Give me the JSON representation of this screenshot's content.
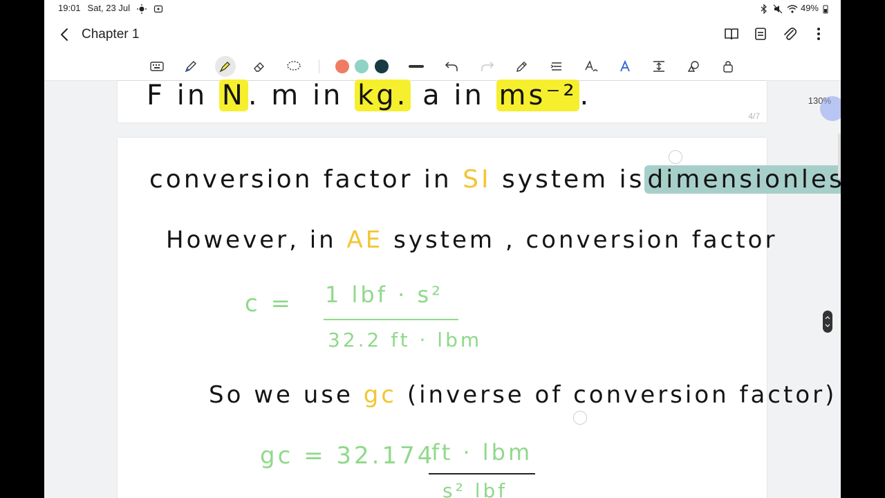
{
  "status": {
    "time": "19:01",
    "date": "Sat, 23 Jul",
    "battery": "49%"
  },
  "titlebar": {
    "title": "Chapter 1",
    "icons": [
      "back-arrow-icon",
      "book-view-icon",
      "page-list-icon",
      "attach-icon",
      "more-options-icon"
    ]
  },
  "toolbar": {
    "tools": [
      "keyboard-icon",
      "pen-icon",
      "highlighter-icon",
      "eraser-icon",
      "lasso-icon",
      "undo-icon",
      "redo-icon",
      "pencil-edit-icon",
      "text-align-icon",
      "handwriting-to-text-icon",
      "text-style-icon",
      "insert-space-icon",
      "shapes-icon",
      "lock-icon"
    ],
    "colors": [
      "#ef7b63",
      "#8fd3c6",
      "#183a43"
    ]
  },
  "canvas": {
    "zoom": "130%",
    "page_indicator": "4/7",
    "prev_page_line": "F in N. m in kg. a in ms⁻².",
    "prev_hl_1": "N",
    "prev_hl_2": "kg.",
    "prev_hl_3": "ms⁻²",
    "line1_a": "conversion factor in",
    "line1_si": "SI",
    "line1_b": "system is",
    "line1_dimless": "dimensionless.",
    "line2_a": "However, in",
    "line2_ae": "AE",
    "line2_b": "system , conversion factor",
    "formula1_lhs": "c =",
    "formula1_num": "1 lbf · s²",
    "formula1_den": "32.2 ft · lbm",
    "line3_a": "So we use",
    "line3_gc": "gc",
    "line3_b": "(inverse of conversion factor)",
    "formula2_lhs": "gc = 32.174",
    "formula2_num": "ft · lbm",
    "formula2_den": "s² lbf"
  }
}
